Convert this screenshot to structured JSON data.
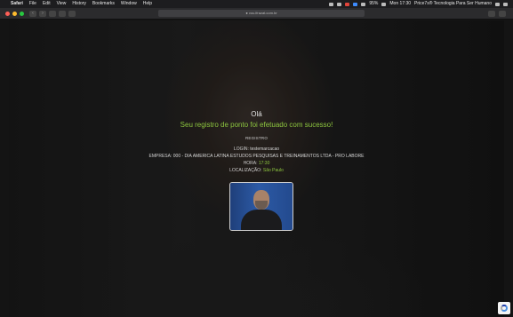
{
  "menubar": {
    "apple": "",
    "app": "Safari",
    "items": [
      "File",
      "Edit",
      "View",
      "History",
      "Bookmarks",
      "Window",
      "Help"
    ],
    "battery": "95%",
    "clock": "Mon 17:30",
    "status_text": "Price7s® Tecnologia Para Ser Humano"
  },
  "toolbar": {
    "address": "● vou.ifrazat.com.br"
  },
  "main": {
    "greeting": "Olá",
    "success": "Seu registro de ponto foi efetuado com sucesso!",
    "section_title": "REGISTRO",
    "login_label": "LOGIN:",
    "login_value": "testemarcacao",
    "empresa_label": "EMPRESA:",
    "empresa_value": "000 - DIA AMERICA LATINA ESTUDOS PESQUISAS E TREINAMENTOS LTDA - PRO LABORE",
    "hora_label": "HORA:",
    "hora_value": "17:30",
    "local_label": "LOCALIZAÇÃO:",
    "local_value": "São Paulo"
  },
  "colors": {
    "success": "#8dc63f",
    "background": "#141414"
  }
}
